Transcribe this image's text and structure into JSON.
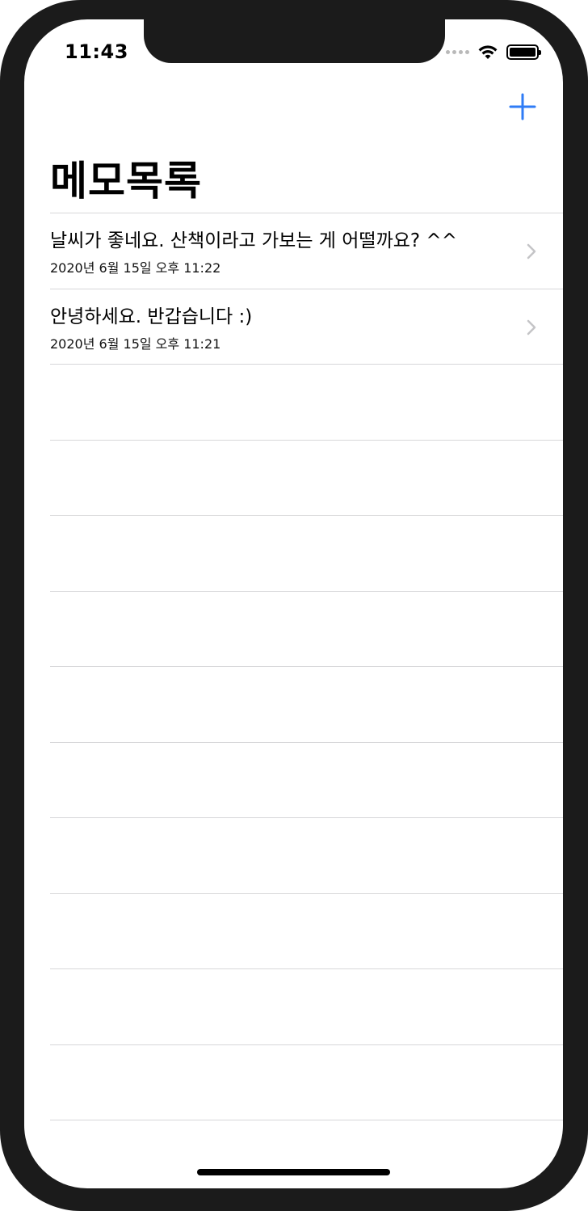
{
  "status_bar": {
    "time": "11:43"
  },
  "nav": {
    "add_icon": "plus-icon",
    "accent_color": "#2f7cf6",
    "title": "메모목록"
  },
  "memos": [
    {
      "title": "날씨가 좋네요. 산책이라고 가보는 게 어떨까요? ^^",
      "date": "2020년 6월 15일 오후 11:22"
    },
    {
      "title": "안녕하세요. 반갑습니다 :)",
      "date": "2020년 6월 15일 오후 11:21"
    }
  ]
}
